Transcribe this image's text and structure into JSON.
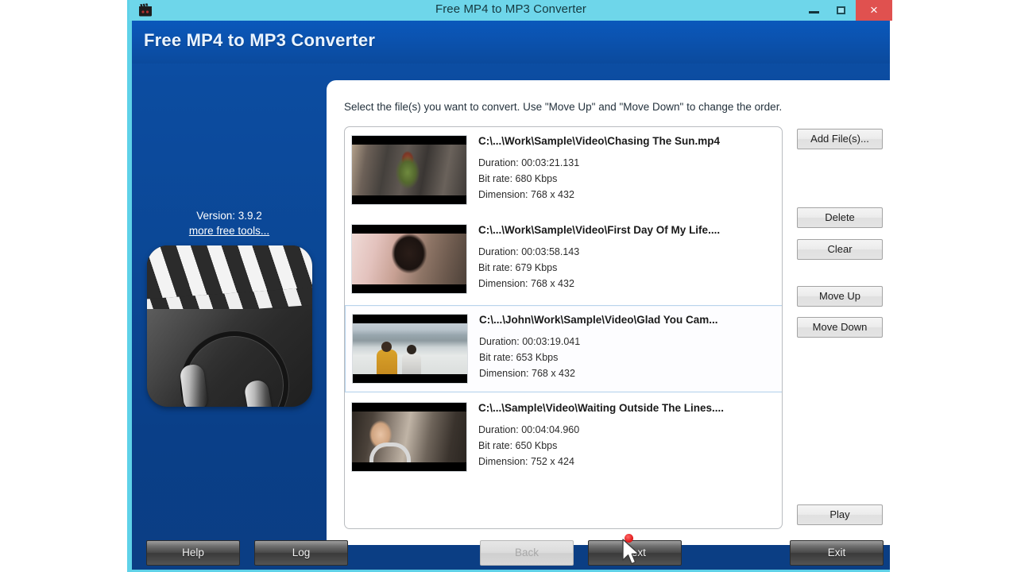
{
  "window": {
    "title": "Free MP4 to MP3 Converter",
    "icon": "clapperboard-icon",
    "minimize_label": "–",
    "maximize_label": "☐",
    "close_label": "×",
    "frame_color": "#5fd2e8",
    "titlebar_color": "#6ed6ea"
  },
  "banner": {
    "title": "Free MP4 to MP3 Converter",
    "background_color": "#0b50a8"
  },
  "sidebar": {
    "version": "Version: 3.9.2",
    "more_tools_link": "more free tools...",
    "logo_icon": "clapperboard-headphones-logo"
  },
  "main": {
    "hint": "Select the file(s) you want to convert. Use \"Move Up\" and \"Move Down\" to change the order.",
    "files": [
      {
        "path": "C:\\...\\Work\\Sample\\Video\\Chasing The Sun.mp4",
        "duration": "Duration: 00:03:21.131",
        "bitrate": "Bit rate: 680 Kbps",
        "dimension": "Dimension: 768 x 432",
        "selected": false,
        "thumbnail": "rocky-landscape-thumbnail"
      },
      {
        "path": "C:\\...\\Work\\Sample\\Video\\First Day Of My Life....",
        "duration": "Duration: 00:03:58.143",
        "bitrate": "Bit rate: 679 Kbps",
        "dimension": "Dimension: 768 x 432",
        "selected": false,
        "thumbnail": "woman-closeup-thumbnail"
      },
      {
        "path": "C:\\...\\John\\Work\\Sample\\Video\\Glad You Cam...",
        "duration": "Duration: 00:03:19.041",
        "bitrate": "Bit rate: 653 Kbps",
        "dimension": "Dimension: 768 x 432",
        "selected": true,
        "thumbnail": "beach-two-people-thumbnail"
      },
      {
        "path": "C:\\...\\Sample\\Video\\Waiting Outside The Lines....",
        "duration": "Duration: 00:04:04.960",
        "bitrate": "Bit rate: 650 Kbps",
        "dimension": "Dimension: 752 x 424",
        "selected": false,
        "thumbnail": "girl-headphones-thumbnail"
      }
    ],
    "side_buttons": {
      "add_files": "Add File(s)...",
      "delete": "Delete",
      "clear": "Clear",
      "move_up": "Move Up",
      "move_down": "Move Down",
      "play": "Play"
    }
  },
  "footer": {
    "help": "Help",
    "log": "Log",
    "back": "Back",
    "next": "Next",
    "exit": "Exit"
  },
  "cursor": {
    "name": "mouse-pointer-over-next-button"
  }
}
